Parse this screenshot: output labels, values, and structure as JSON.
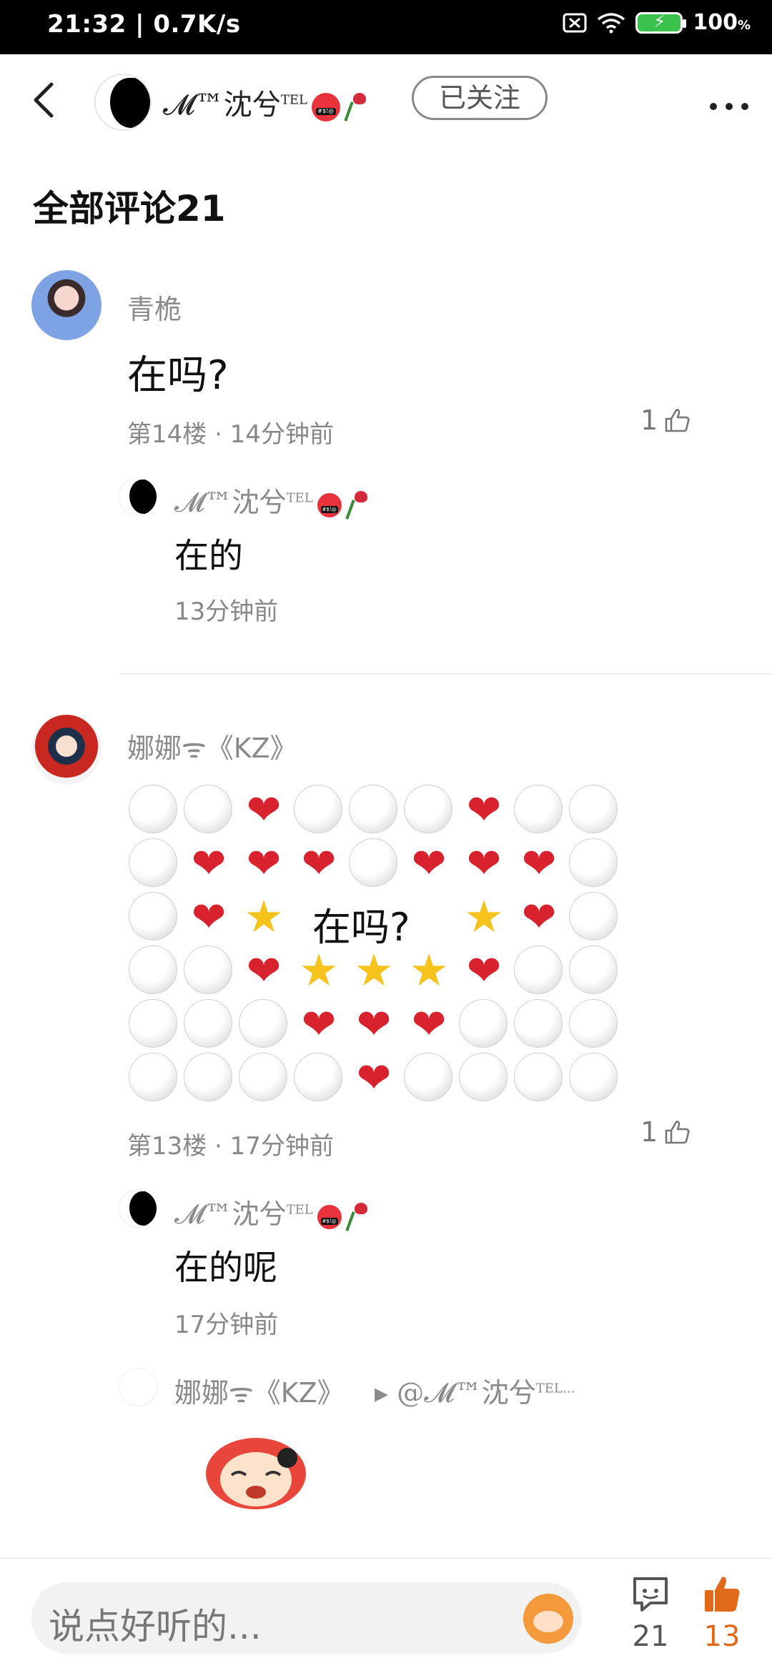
{
  "status_bar": {
    "time_speed": "21:32 | 0.7K/s",
    "battery_pct": "100"
  },
  "header": {
    "back_icon": "chevron-left",
    "username": "𝓜™沈兮",
    "username_suffix": "TEL",
    "follow_label": "已关注",
    "more_icon": "more-dots"
  },
  "section": {
    "title": "全部评论21"
  },
  "comments": [
    {
      "username": "青桅",
      "text": "在吗?",
      "meta": "第14楼 · 14分钟前",
      "likes": "1",
      "reply": {
        "username": "𝓜™沈兮",
        "username_suffix": "TEL",
        "text": "在的",
        "time": "13分钟前"
      }
    },
    {
      "username": "娜娜ᯤ《KZ》",
      "grid_text": "在吗?",
      "meta": "第13楼 · 17分钟前",
      "likes": "1",
      "reply": {
        "username": "𝓜™沈兮",
        "username_suffix": "TEL",
        "text": "在的呢",
        "time": "17分钟前"
      },
      "reply2": {
        "username": "娜娜ᯤ《KZ》",
        "mention": "▸ @𝓜™沈兮",
        "mention_suffix": "TEL…"
      }
    }
  ],
  "bottom_bar": {
    "input_placeholder": "说点好听的...",
    "comment_count": "21",
    "like_count": "13"
  },
  "colors": {
    "accent_orange": "#e06a1a",
    "grey_text": "#8a8a8a"
  }
}
